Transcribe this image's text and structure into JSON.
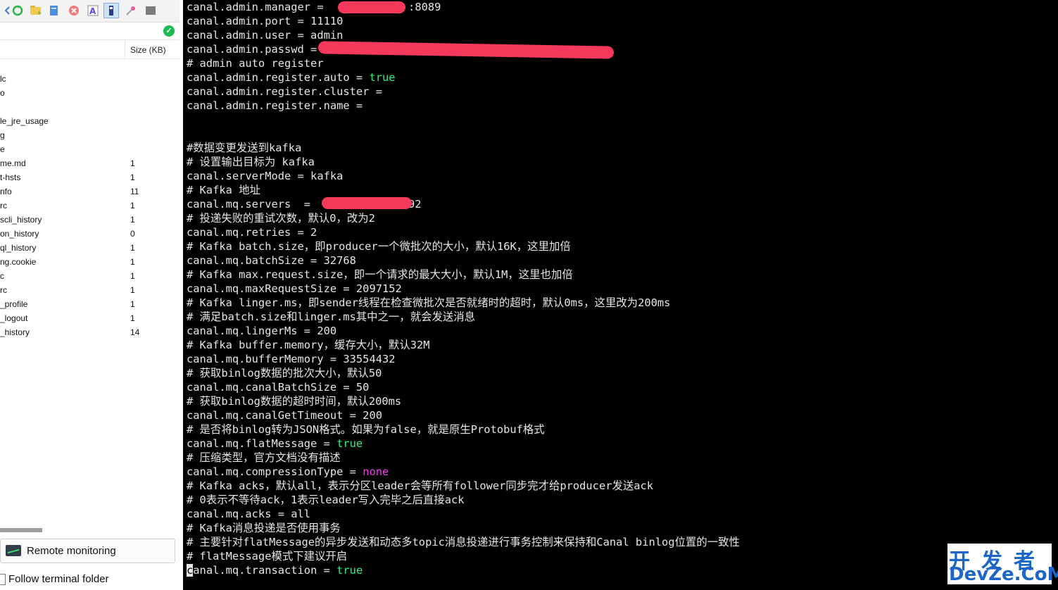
{
  "file_panel": {
    "toolbar_icons": [
      "back-arrow-icon",
      "refresh-icon",
      "new-folder-icon",
      "new-file-icon",
      "delete-icon",
      "rename-icon",
      "text-editor-icon",
      "properties-icon",
      "terminal-icon"
    ],
    "size_header": "Size (KB)",
    "files": [
      {
        "name": "lc",
        "size": ""
      },
      {
        "name": "o",
        "size": ""
      },
      {
        "name": "",
        "size": ""
      },
      {
        "name": "le_jre_usage",
        "size": ""
      },
      {
        "name": "g",
        "size": ""
      },
      {
        "name": "e",
        "size": ""
      },
      {
        "name": "me.md",
        "size": "1"
      },
      {
        "name": "t-hsts",
        "size": "1"
      },
      {
        "name": "nfo",
        "size": "11"
      },
      {
        "name": "rc",
        "size": "1"
      },
      {
        "name": "scli_history",
        "size": "1"
      },
      {
        "name": "on_history",
        "size": "0"
      },
      {
        "name": "ql_history",
        "size": "1"
      },
      {
        "name": "ng.cookie",
        "size": "1"
      },
      {
        "name": "c",
        "size": "1"
      },
      {
        "name": "rc",
        "size": "1"
      },
      {
        "name": "_profile",
        "size": "1"
      },
      {
        "name": "_logout",
        "size": "1"
      },
      {
        "name": "_history",
        "size": "14"
      }
    ],
    "remote_monitoring": "Remote monitoring",
    "follow_terminal": "Follow terminal folder"
  },
  "terminal": {
    "lines": [
      [
        {
          "t": "canal.admin.manager = "
        },
        {
          "t": "            :8089"
        }
      ],
      [
        {
          "t": "canal.admin.port = 11110"
        }
      ],
      [
        {
          "t": "canal.admin.user = admin"
        }
      ],
      [
        {
          "t": "canal.admin.passwd = "
        }
      ],
      [
        {
          "t": "# admin auto register"
        }
      ],
      [
        {
          "t": "canal.admin.register.auto = "
        },
        {
          "t": "true",
          "c": "t"
        }
      ],
      [
        {
          "t": "canal.admin.register.cluster ="
        }
      ],
      [
        {
          "t": "canal.admin.register.name ="
        }
      ],
      [
        {
          "t": ""
        }
      ],
      [
        {
          "t": ""
        }
      ],
      [
        {
          "t": "#数据变更发送到kafka"
        }
      ],
      [
        {
          "t": "# 设置输出目标为 kafka"
        }
      ],
      [
        {
          "t": "canal.serverMode = kafka"
        }
      ],
      [
        {
          "t": "# Kafka 地址"
        }
      ],
      [
        {
          "t": "canal.mq.servers  =            :9092"
        }
      ],
      [
        {
          "t": "# 投递失败的重试次数，默认0，改为2"
        }
      ],
      [
        {
          "t": "canal.mq.retries = 2"
        }
      ],
      [
        {
          "t": "# Kafka batch.size，即producer一个微批次的大小，默认16K，这里加倍"
        }
      ],
      [
        {
          "t": "canal.mq.batchSize = 32768"
        }
      ],
      [
        {
          "t": "# Kafka max.request.size，即一个请求的最大大小，默认1M，这里也加倍"
        }
      ],
      [
        {
          "t": "canal.mq.maxRequestSize = 2097152"
        }
      ],
      [
        {
          "t": "# Kafka linger.ms，即sender线程在检查微批次是否就绪时的超时，默认0ms，这里改为200ms"
        }
      ],
      [
        {
          "t": "# 满足batch.size和linger.ms其中之一，就会发送消息"
        }
      ],
      [
        {
          "t": "canal.mq.lingerMs = 200"
        }
      ],
      [
        {
          "t": "# Kafka buffer.memory，缓存大小，默认32M"
        }
      ],
      [
        {
          "t": "canal.mq.bufferMemory = 33554432"
        }
      ],
      [
        {
          "t": "# 获取binlog数据的批次大小，默认50"
        }
      ],
      [
        {
          "t": "canal.mq.canalBatchSize = 50"
        }
      ],
      [
        {
          "t": "# 获取binlog数据的超时时间，默认200ms"
        }
      ],
      [
        {
          "t": "canal.mq.canalGetTimeout = 200"
        }
      ],
      [
        {
          "t": "# 是否将binlog转为JSON格式。如果为false，就是原生Protobuf格式"
        }
      ],
      [
        {
          "t": "canal.mq.flatMessage = "
        },
        {
          "t": "true",
          "c": "t"
        }
      ],
      [
        {
          "t": "# 压缩类型，官方文档没有描述"
        }
      ],
      [
        {
          "t": "canal.mq.compressionType = "
        },
        {
          "t": "none",
          "c": "p"
        }
      ],
      [
        {
          "t": "# Kafka acks，默认all，表示分区leader会等所有follower同步完才给producer发送ack"
        }
      ],
      [
        {
          "t": "# 0表示不等待ack，1表示leader写入完毕之后直接ack"
        }
      ],
      [
        {
          "t": "canal.mq.acks = all"
        }
      ],
      [
        {
          "t": "# Kafka消息投递是否使用事务"
        }
      ],
      [
        {
          "t": "# 主要针对flatMessage的异步发送和动态多topic消息投递进行事务控制来保持和Canal binlog位置的一致性"
        }
      ],
      [
        {
          "t": "# flatMessage模式下建议开启"
        }
      ],
      [
        {
          "t": "c",
          "c": "cur"
        },
        {
          "t": "anal.mq.transaction = "
        },
        {
          "t": "true",
          "c": "t"
        }
      ]
    ]
  },
  "watermark": {
    "top": "开发者",
    "bottom": "DevZe.CoM"
  },
  "colors": {
    "true_keyword": "#2cf087",
    "none_keyword": "#f337ee",
    "redaction": "#f5395c",
    "watermark": "#1d66c9"
  }
}
